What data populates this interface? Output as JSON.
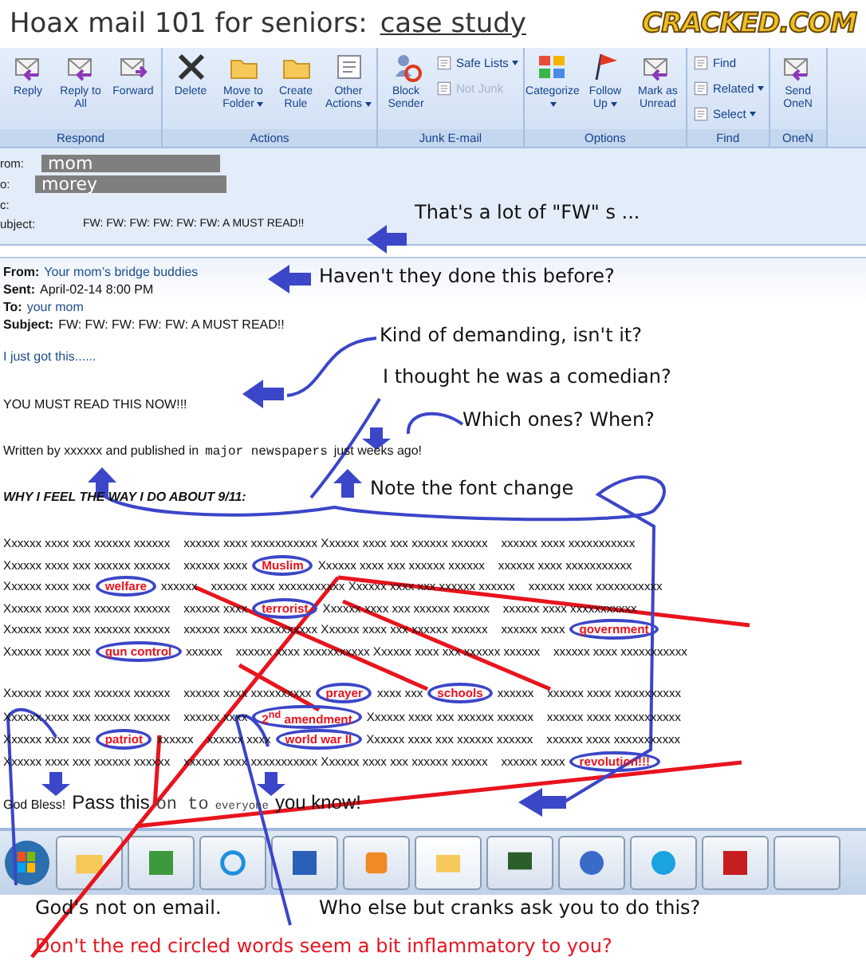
{
  "header": {
    "title": "Hoax mail 101 for seniors:",
    "subtitle": "case study",
    "logo": "CRACKED.COM"
  },
  "ribbon": {
    "groups": [
      {
        "label": "Respond",
        "buttons": [
          {
            "label": "Reply",
            "kind": "large",
            "dropdown": false
          },
          {
            "label": "Reply to All",
            "kind": "large",
            "dropdown": false
          },
          {
            "label": "Forward",
            "kind": "large",
            "dropdown": false
          }
        ]
      },
      {
        "label": "Actions",
        "buttons": [
          {
            "label": "Delete",
            "kind": "large",
            "dropdown": false
          },
          {
            "label": "Move to Folder",
            "kind": "large",
            "dropdown": true
          },
          {
            "label": "Create Rule",
            "kind": "large",
            "dropdown": false
          },
          {
            "label": "Other Actions",
            "kind": "large",
            "dropdown": true
          }
        ]
      },
      {
        "label": "Junk E-mail",
        "buttons": [
          {
            "label": "Block Sender",
            "kind": "large",
            "dropdown": false
          },
          {
            "label": "Safe Lists",
            "kind": "small",
            "dropdown": true
          },
          {
            "label": "Not Junk",
            "kind": "small",
            "dropdown": false,
            "disabled": true
          }
        ]
      },
      {
        "label": "Options",
        "buttons": [
          {
            "label": "Categorize",
            "kind": "large",
            "dropdown": true
          },
          {
            "label": "Follow Up",
            "kind": "large",
            "dropdown": true
          },
          {
            "label": "Mark as Unread",
            "kind": "large",
            "dropdown": false
          }
        ]
      },
      {
        "label": "Find",
        "buttons": [
          {
            "label": "Find",
            "kind": "small",
            "dropdown": false
          },
          {
            "label": "Related",
            "kind": "small",
            "dropdown": true
          },
          {
            "label": "Select",
            "kind": "small",
            "dropdown": true
          }
        ]
      },
      {
        "label": "OneN",
        "buttons": [
          {
            "label": "Send OneN",
            "kind": "large",
            "dropdown": false
          }
        ]
      }
    ]
  },
  "fields": [
    {
      "label": "rom:",
      "value": "mom",
      "kind": "redacted"
    },
    {
      "label": "o:",
      "value": "morey",
      "kind": "redacted"
    },
    {
      "label": "c:",
      "kind": "plain"
    },
    {
      "label": "ubject:",
      "value": "FW: FW: FW: FW: FW: FW: A MUST READ!!",
      "kind": "plain"
    }
  ],
  "meta": [
    {
      "label": "From:",
      "value": "Your mom’s bridge buddies",
      "link": true
    },
    {
      "label": "Sent:",
      "value": "April-02-14 8:00 PM",
      "link": false
    },
    {
      "label": "To:",
      "value": "your mom",
      "link": true
    },
    {
      "label": "Subject:",
      "value": "FW: FW: FW: FW: FW: A MUST READ!!",
      "link": false
    }
  ],
  "paragraphs": [
    {
      "kind": "blue",
      "segments": [
        {
          "text": "I just got this......",
          "kind": "sans"
        }
      ]
    },
    {
      "kind": "plain",
      "segments": [
        {
          "text": "YOU MUST READ THIS NOW!!!",
          "kind": "sans"
        }
      ]
    },
    {
      "kind": "plain",
      "segments": [
        {
          "text": "Written by xxxxxx and published in",
          "kind": "sans"
        },
        {
          "text": "major newspapers",
          "kind": "mono"
        },
        {
          "text": "just weeks ago!",
          "kind": "sans"
        }
      ]
    },
    {
      "kind": "heading",
      "segments": [
        {
          "text": "WHY I FEEL THE WAY I DO ABOUT 9/11:",
          "kind": "sans"
        }
      ]
    }
  ],
  "blocks": [
    [
      [
        {
          "text": "Xxxxxx xxxx xxx xxxxxx xxxxxx    xxxxxx xxxx xxxxxxxxxxx Xxxxxx xxxx xxx xxxxxx xxxxxx    xxxxxx xxxx xxxxxxxxxxx",
          "flagged": false
        }
      ],
      [
        {
          "text": "Xxxxxx xxxx xxx xxxxxx xxxxxx    xxxxxx xxxx",
          "flagged": false
        },
        {
          "text": "Muslim",
          "flagged": true
        },
        {
          "text": "Xxxxxx xxxx xxx xxxxxx xxxxxx    xxxxxx xxxx xxxxxxxxxxx",
          "flagged": false
        }
      ],
      [
        {
          "text": "Xxxxxx xxxx xxx",
          "flagged": false
        },
        {
          "text": "welfare",
          "flagged": true
        },
        {
          "text": "xxxxxx    xxxxxx xxxx xxxxxxxxxxx Xxxxxx xxxx xxx xxxxxx xxxxxx    xxxxxx xxxx xxxxxxxxxxx",
          "flagged": false
        }
      ],
      [
        {
          "text": "Xxxxxx xxxx xxx xxxxxx xxxxxx    xxxxxx xxxx",
          "flagged": false
        },
        {
          "text": "terrorist",
          "flagged": true
        },
        {
          "text": "Xxxxxx xxxx xxx xxxxxx xxxxxx    xxxxxx xxxx xxxxxxxxxxx",
          "flagged": false
        }
      ],
      [
        {
          "text": "Xxxxxx xxxx xxx xxxxxx xxxxxx    xxxxxx xxxx xxxxxxxxxxx Xxxxxx xxxx xxx xxxxxx xxxxxx    xxxxxx xxxx",
          "flagged": false
        },
        {
          "text": "government",
          "flagged": true
        }
      ],
      [
        {
          "text": "Xxxxxx xxxx xxx",
          "flagged": false
        },
        {
          "text": "gun control",
          "flagged": true
        },
        {
          "text": "xxxxxx    xxxxxx xxxx xxxxxxxxxxx Xxxxxx xxxx xxx xxxxxx xxxxxx    xxxxxx xxxx xxxxxxxxxxx",
          "flagged": false
        }
      ]
    ],
    [
      [
        {
          "text": "Xxxxxx xxxx xxx xxxxxx xxxxxx    xxxxxx xxxx xxxxxxxxxx",
          "flagged": false
        },
        {
          "text": "prayer",
          "flagged": true
        },
        {
          "text": "xxxx xxx",
          "flagged": false
        },
        {
          "text": "schools",
          "flagged": true
        },
        {
          "text": "xxxxxx    xxxxxx xxxx xxxxxxxxxxx",
          "flagged": false
        }
      ],
      [
        {
          "text": "Xxxxxx xxxx xxx xxxxxx xxxxxx    xxxxxx xxxx",
          "flagged": false
        },
        {
          "text": "2$^{nd}$ amendment",
          "flagged": true
        },
        {
          "text": "Xxxxxx xxxx xxx xxxxxx xxxxxx    xxxxxx xxxx xxxxxxxxxxx",
          "flagged": false
        }
      ],
      [
        {
          "text": "Xxxxxx xxxx xxx",
          "flagged": false
        },
        {
          "text": "patriot",
          "flagged": true
        },
        {
          "text": "xxxxxx    xxxxxx xxxx",
          "flagged": false
        },
        {
          "text": "world war II",
          "flagged": true
        },
        {
          "text": "Xxxxxx xxxx xxx xxxxxx xxxxxx    xxxxxx xxxx xxxxxxxxxxx",
          "flagged": false
        }
      ],
      [
        {
          "text": "Xxxxxx xxxx xxx xxxxxx xxxxxx    xxxxxx xxxx xxxxxxxxxxx Xxxxxx xxxx xxx xxxxxx xxxxxx    xxxxxx xxxx",
          "flagged": false
        },
        {
          "text": "revolution!!!",
          "flagged": true
        }
      ]
    ]
  ],
  "closing": [
    {
      "text": "God Bless!",
      "kind": "small"
    },
    {
      "text": "Pass this",
      "kind": "big"
    },
    {
      "text": "on to",
      "kind": "mono"
    },
    {
      "text": "everyone",
      "kind": "tinymono"
    },
    {
      "text": "you know!",
      "kind": "big"
    }
  ],
  "annotations": [
    {
      "text": "That's a lot of \"FW\" s ...",
      "kind": "note"
    },
    {
      "text": "Haven't they done this before?",
      "kind": "note"
    },
    {
      "text": "Kind of demanding, isn't it?",
      "kind": "note"
    },
    {
      "text": "I thought he was a comedian?",
      "kind": "note"
    },
    {
      "text": "Which ones?  When?",
      "kind": "note"
    },
    {
      "text": "Note the font change",
      "kind": "note"
    },
    {
      "text": "God's not on email.",
      "kind": "note"
    },
    {
      "text": "Who else but cranks ask you to do this?",
      "kind": "note"
    },
    {
      "text": "Don't the red circled words seem a bit inflammatory to you?",
      "kind": "alert"
    }
  ]
}
